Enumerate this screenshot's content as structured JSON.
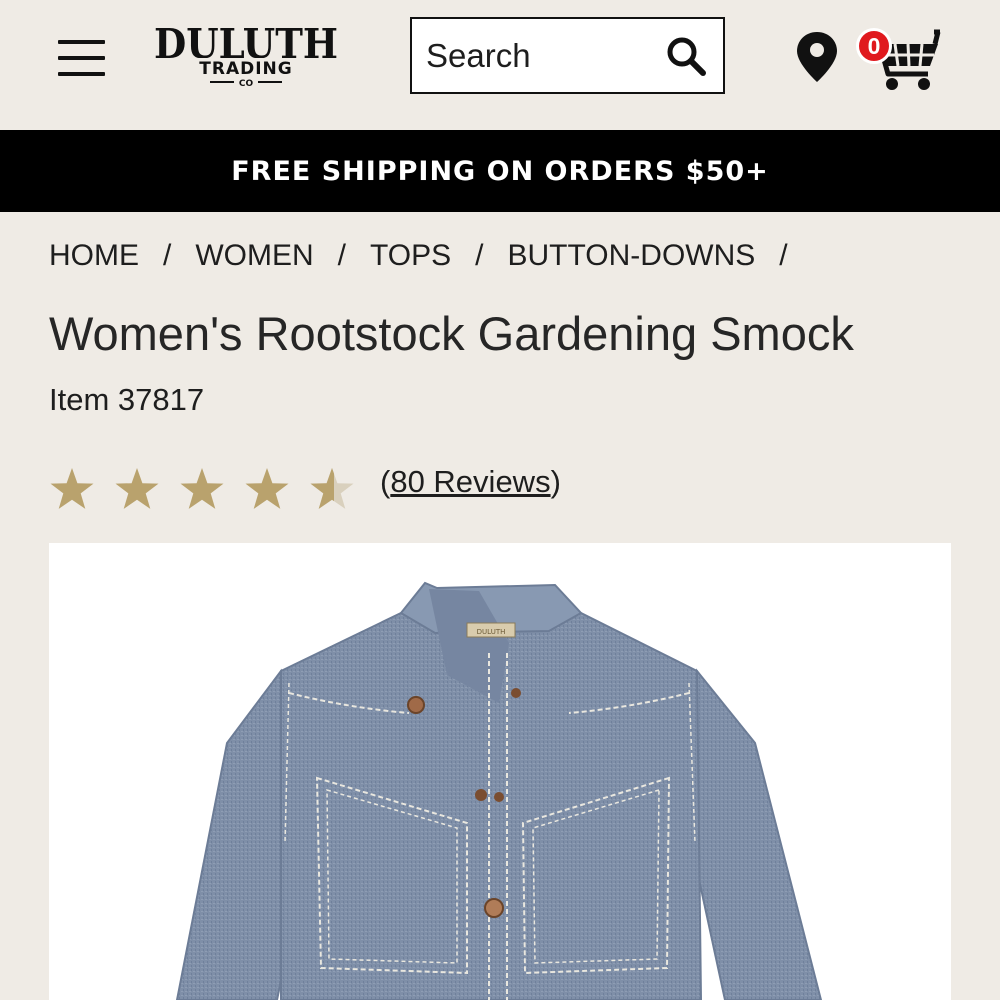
{
  "header": {
    "logo": {
      "top": "DULUTH",
      "middle": "TRADING",
      "bottom": "CO"
    },
    "search": {
      "placeholder": "Search"
    },
    "cart": {
      "count": "0"
    }
  },
  "promo": {
    "text": "FREE SHIPPING ON ORDERS $50+"
  },
  "breadcrumb": [
    "HOME",
    "WOMEN",
    "TOPS",
    "BUTTON-DOWNS"
  ],
  "product": {
    "title": "Women's Rootstock Gardening Smock",
    "item_number": "Item 37817",
    "rating": 4.5,
    "reviews_label": "80 Reviews",
    "label_tag": "DULUTH"
  },
  "colors": {
    "background": "#efebe5",
    "banner": "#000000",
    "star": "#b9a26d",
    "badge": "#e0191e",
    "denim": "#7f8fa8"
  },
  "icons": [
    "menu-icon",
    "search-icon",
    "location-pin-icon",
    "cart-icon",
    "star-icon"
  ]
}
